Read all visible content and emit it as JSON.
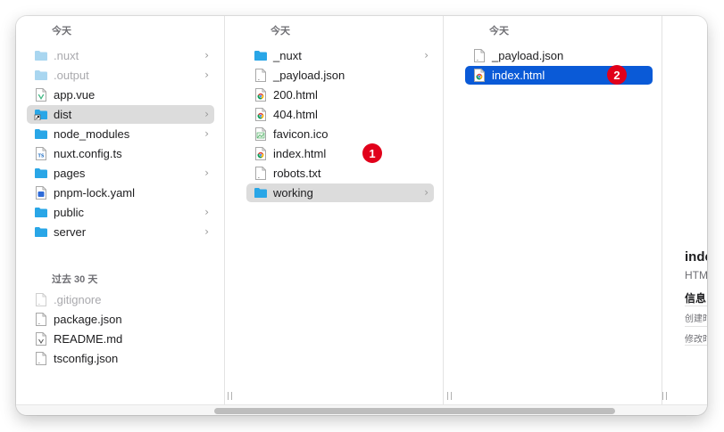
{
  "columns": [
    {
      "header": "今天",
      "items": [
        {
          "name": ".nuxt",
          "type": "folder",
          "dim": true,
          "chevron": true,
          "selected": false
        },
        {
          "name": ".output",
          "type": "folder",
          "dim": true,
          "chevron": true,
          "selected": false
        },
        {
          "name": "app.vue",
          "type": "vue",
          "dim": false,
          "chevron": false,
          "selected": false
        },
        {
          "name": "dist",
          "type": "alias-folder",
          "dim": false,
          "chevron": true,
          "selected": "gray"
        },
        {
          "name": "node_modules",
          "type": "folder",
          "dim": false,
          "chevron": true,
          "selected": false
        },
        {
          "name": "nuxt.config.ts",
          "type": "ts",
          "dim": false,
          "chevron": false,
          "selected": false
        },
        {
          "name": "pages",
          "type": "folder",
          "dim": false,
          "chevron": true,
          "selected": false
        },
        {
          "name": "pnpm-lock.yaml",
          "type": "yaml",
          "dim": false,
          "chevron": false,
          "selected": false
        },
        {
          "name": "public",
          "type": "folder",
          "dim": false,
          "chevron": true,
          "selected": false
        },
        {
          "name": "server",
          "type": "folder",
          "dim": false,
          "chevron": true,
          "selected": false
        }
      ],
      "header2": "过去 30 天",
      "items2": [
        {
          "name": ".gitignore",
          "type": "file",
          "dim": true,
          "chevron": false,
          "selected": false
        },
        {
          "name": "package.json",
          "type": "file",
          "dim": false,
          "chevron": false,
          "selected": false
        },
        {
          "name": "README.md",
          "type": "md",
          "dim": false,
          "chevron": false,
          "selected": false
        },
        {
          "name": "tsconfig.json",
          "type": "file",
          "dim": false,
          "chevron": false,
          "selected": false
        }
      ]
    },
    {
      "header": "今天",
      "items": [
        {
          "name": "_nuxt",
          "type": "folder",
          "dim": false,
          "chevron": true,
          "selected": false
        },
        {
          "name": "_payload.json",
          "type": "file",
          "dim": false,
          "chevron": false,
          "selected": false
        },
        {
          "name": "200.html",
          "type": "html",
          "dim": false,
          "chevron": false,
          "selected": false
        },
        {
          "name": "404.html",
          "type": "html",
          "dim": false,
          "chevron": false,
          "selected": false
        },
        {
          "name": "favicon.ico",
          "type": "ico",
          "dim": false,
          "chevron": false,
          "selected": false
        },
        {
          "name": "index.html",
          "type": "html",
          "dim": false,
          "chevron": false,
          "selected": false
        },
        {
          "name": "robots.txt",
          "type": "file",
          "dim": false,
          "chevron": false,
          "selected": false
        },
        {
          "name": "working",
          "type": "folder",
          "dim": false,
          "chevron": true,
          "selected": "gray"
        }
      ]
    },
    {
      "header": "今天",
      "items": [
        {
          "name": "_payload.json",
          "type": "file",
          "dim": false,
          "chevron": false,
          "selected": false
        },
        {
          "name": "index.html",
          "type": "html",
          "dim": false,
          "chevron": false,
          "selected": "blue"
        }
      ]
    }
  ],
  "badges": [
    "1",
    "2"
  ],
  "preview": {
    "title": "inde",
    "kind": "HTM",
    "info_label": "信息",
    "created_label": "创建时",
    "modified_label": "修改时"
  },
  "colors": {
    "folder": "#29a6e6",
    "folder_dim": "#a9d6f0",
    "selection_blue": "#0a5ad7",
    "selection_gray": "#dcdcdc",
    "badge": "#e1001a"
  },
  "grip": "||"
}
